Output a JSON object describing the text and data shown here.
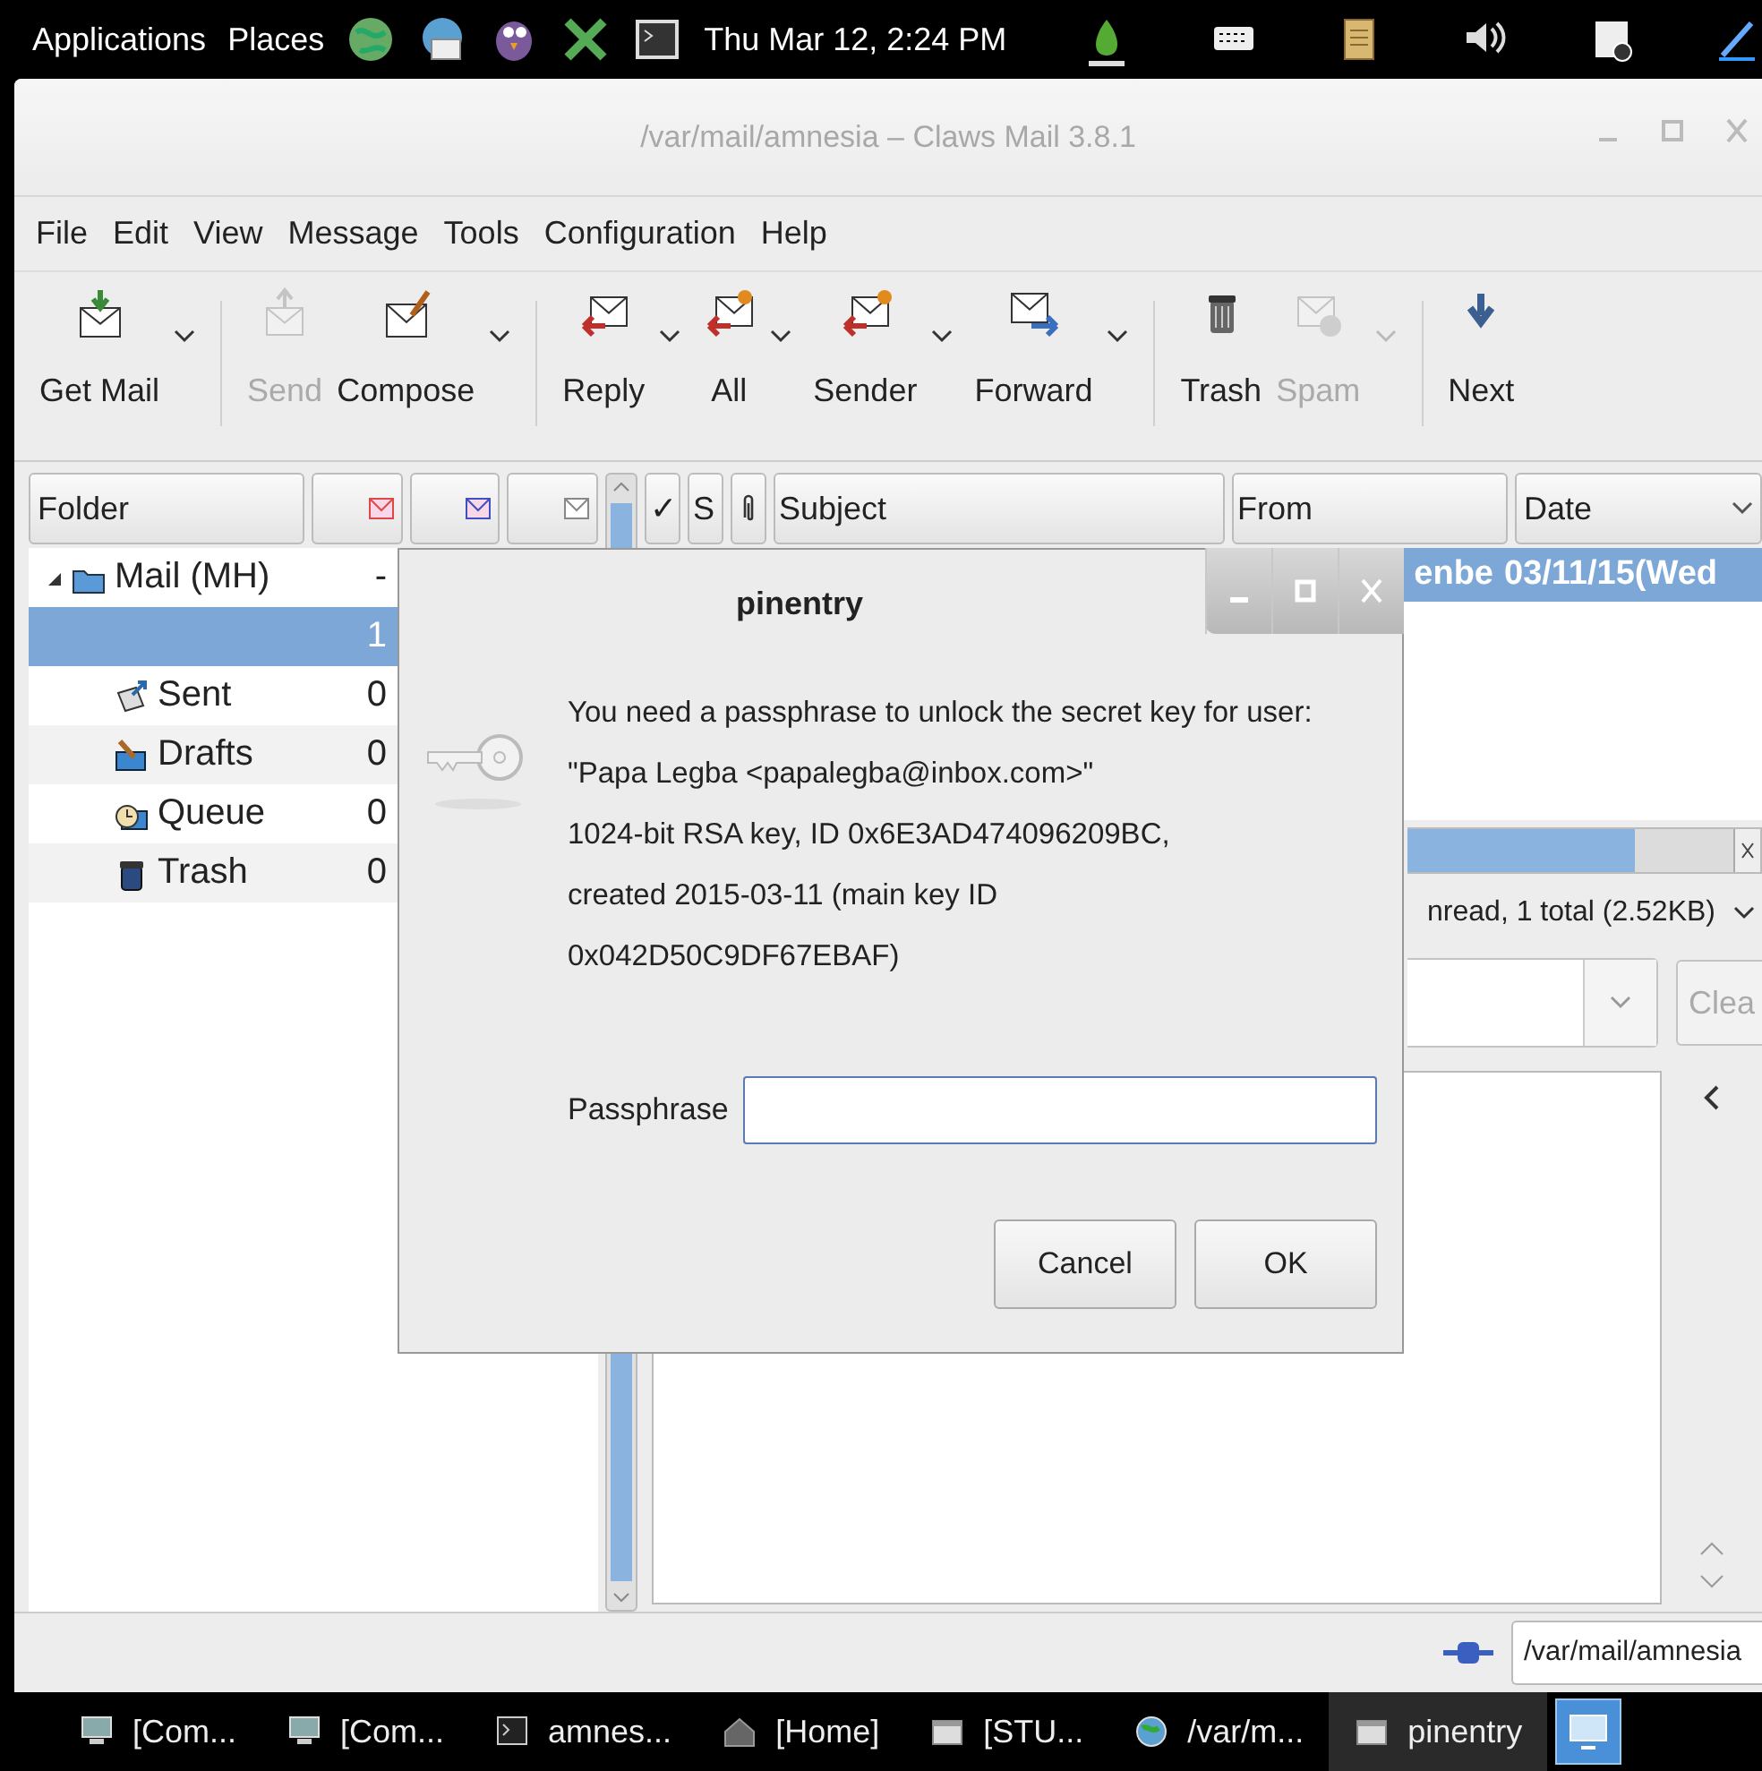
{
  "top_panel": {
    "menus": [
      {
        "label": "Applications"
      },
      {
        "label": "Places"
      }
    ],
    "launchers": [
      {
        "kind": "globe"
      },
      {
        "kind": "mail"
      },
      {
        "kind": "chat"
      },
      {
        "kind": "tools"
      },
      {
        "kind": "terminal"
      }
    ],
    "clock": "Thu Mar 12,  2:24 PM",
    "tray": [
      {
        "kind": "onion"
      },
      {
        "kind": "keyboard"
      },
      {
        "kind": "clipboard"
      },
      {
        "kind": "volume"
      },
      {
        "kind": "notes"
      },
      {
        "kind": "pen"
      }
    ]
  },
  "window": {
    "title": "/var/mail/amnesia – Claws Mail 3.8.1"
  },
  "menu_bar": [
    {
      "label": "File"
    },
    {
      "label": "Edit"
    },
    {
      "label": "View"
    },
    {
      "label": "Message"
    },
    {
      "label": "Tools"
    },
    {
      "label": "Configuration"
    },
    {
      "label": "Help"
    }
  ],
  "toolbar": [
    {
      "items": [
        {
          "kind": "get_mail",
          "label": "Get Mail",
          "disabled": false,
          "has_menu": true
        }
      ]
    },
    {
      "items": [
        {
          "kind": "send",
          "label": "Send",
          "disabled": true,
          "has_menu": false
        },
        {
          "kind": "compose",
          "label": "Compose",
          "disabled": false,
          "has_menu": true
        }
      ]
    },
    {
      "items": [
        {
          "kind": "reply",
          "label": "Reply",
          "disabled": false,
          "has_menu": true
        },
        {
          "kind": "reply_all",
          "label": "All",
          "disabled": false,
          "has_menu": true
        },
        {
          "kind": "reply_sender",
          "label": "Sender",
          "disabled": false,
          "has_menu": true
        },
        {
          "kind": "forward",
          "label": "Forward",
          "disabled": false,
          "has_menu": true
        }
      ]
    },
    {
      "items": [
        {
          "kind": "trash",
          "label": "Trash",
          "disabled": false,
          "has_menu": false
        },
        {
          "kind": "spam",
          "label": "Spam",
          "disabled": true,
          "has_menu": true
        }
      ]
    },
    {
      "items": [
        {
          "kind": "next",
          "label": "Next",
          "disabled": false,
          "has_menu": false
        }
      ]
    }
  ],
  "folder_pane": {
    "columns": [
      {
        "kind": "text",
        "label": "Folder"
      },
      {
        "kind": "unread"
      },
      {
        "kind": "new"
      },
      {
        "kind": "total"
      }
    ],
    "tree": [
      {
        "kind": "mailbox",
        "name": "Mail (MH)",
        "count": "-",
        "expanded": true,
        "selected": false,
        "children": [
          {
            "count": "1",
            "selected": true
          },
          {
            "kind": "sent",
            "name": "Sent",
            "count": "0",
            "selected": false
          },
          {
            "kind": "drafts",
            "name": "Drafts",
            "count": "0",
            "selected": false
          },
          {
            "kind": "queue",
            "name": "Queue",
            "count": "0",
            "selected": false
          },
          {
            "kind": "trash",
            "name": "Trash",
            "count": "0",
            "selected": false
          }
        ]
      }
    ]
  },
  "message_list": {
    "columns": [
      {
        "kind": "mark",
        "label": "✓"
      },
      {
        "kind": "status",
        "label": "S"
      },
      {
        "kind": "attach"
      },
      {
        "kind": "subject",
        "label": "Subject"
      },
      {
        "kind": "from",
        "label": "From"
      },
      {
        "kind": "date",
        "label": "Date"
      }
    ],
    "rows": [
      {
        "from": "enbe",
        "date": "03/11/15(Wed",
        "selected": true
      }
    ],
    "summary": "nread, 1 total (2.52KB)",
    "clear_button": {
      "label": "Clea",
      "disabled": true
    }
  },
  "status_bar": {
    "folder_path": "/var/mail/amnesia"
  },
  "dialog": {
    "title": "pinentry",
    "message": [
      "You need a passphrase to unlock the secret key for user:",
      "\"Papa Legba <papalegba@inbox.com>\"",
      "1024-bit RSA key, ID 0x6E3AD474096209BC,",
      "created 2015-03-11 (main key ID",
      "0x042D50C9DF67EBAF)"
    ],
    "field_label": "Passphrase",
    "buttons": [
      {
        "label": "Cancel"
      },
      {
        "label": "OK"
      }
    ]
  },
  "taskbar": [
    {
      "kind": "computer",
      "label": "[Com...",
      "selected": false
    },
    {
      "kind": "computer",
      "label": "[Com...",
      "selected": false
    },
    {
      "kind": "terminal",
      "label": "amnes...",
      "selected": false
    },
    {
      "kind": "home",
      "label": "[Home]",
      "selected": false
    },
    {
      "kind": "window",
      "label": "[STU...",
      "selected": false
    },
    {
      "kind": "mail",
      "label": "/var/m...",
      "selected": false
    },
    {
      "kind": "window",
      "label": "pinentry",
      "selected": true
    }
  ]
}
